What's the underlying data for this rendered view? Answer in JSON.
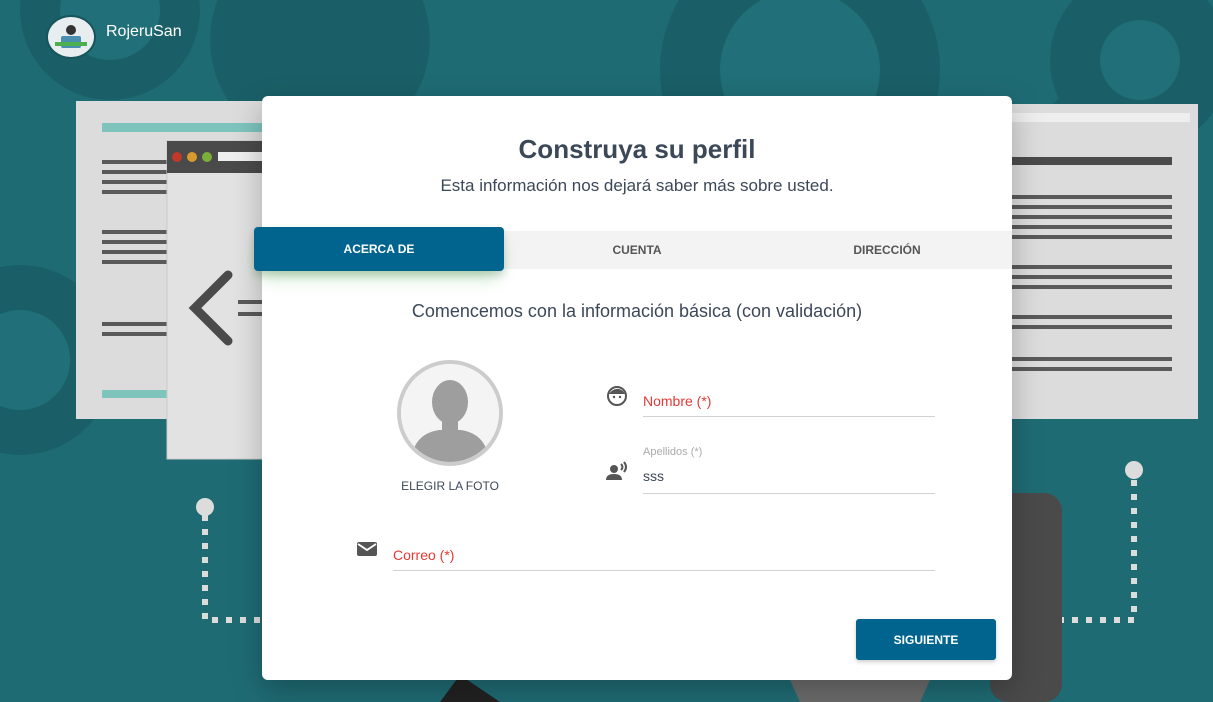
{
  "brand": {
    "name": "RojeruSan"
  },
  "card": {
    "title": "Construya su perfil",
    "subtitle": "Esta información nos dejará saber más sobre usted."
  },
  "tabs": [
    {
      "label": "ACERCA DE",
      "active": true
    },
    {
      "label": "CUENTA",
      "active": false
    },
    {
      "label": "DIRECCIÓN",
      "active": false
    }
  ],
  "form": {
    "heading": "Comencemos con la información básica (con validación)",
    "photo_label": "ELEGIR LA FOTO",
    "nombre": {
      "placeholder": "Nombre (*)",
      "icon": "face-icon"
    },
    "apellidos": {
      "label": "Apellidos (*)",
      "value": "sss",
      "icon": "record-voice-icon"
    },
    "correo": {
      "placeholder": "Correo (*)",
      "icon": "email-icon"
    }
  },
  "actions": {
    "next_label": "SIGUIENTE"
  },
  "colors": {
    "primary": "#00648f",
    "background": "#1f6b74",
    "required": "#e53935"
  }
}
